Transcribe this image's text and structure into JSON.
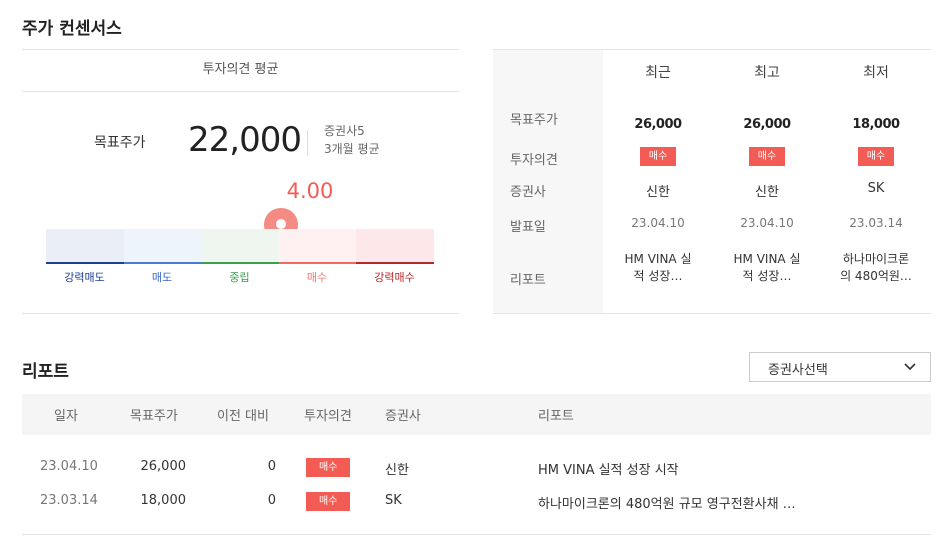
{
  "page": {
    "title": "주가 컨센서스"
  },
  "average": {
    "header": "투자의견 평균",
    "target_label": "목표주가",
    "target_value": "22,000",
    "brokers": "증권사5",
    "period": "3개월 평균",
    "score": "4.00",
    "score_value": 4.0,
    "scale": [
      {
        "label": "강력매도",
        "text_color": "#1f3f8f",
        "bg": "#e9eef7",
        "line": "#1f3f8f"
      },
      {
        "label": "매도",
        "text_color": "#3a6ac4",
        "bg": "#eef4fc",
        "line": "#4a7bd1"
      },
      {
        "label": "중립",
        "text_color": "#3b9b4c",
        "bg": "#eef6ef",
        "line": "#3e9d4f"
      },
      {
        "label": "매수",
        "text_color": "#f07a72",
        "bg": "#fff1f1",
        "line": "#f06a62"
      },
      {
        "label": "강력매수",
        "text_color": "#b3292b",
        "bg": "#fde7e8",
        "line": "#b3292b"
      }
    ],
    "accent": "#f25c54"
  },
  "compare": {
    "columns": [
      "최근",
      "최고",
      "최저"
    ],
    "row_labels": [
      "목표주가",
      "투자의견",
      "증권사",
      "발표일",
      "리포트"
    ],
    "cells": [
      {
        "target": "26,000",
        "opinion": "매수",
        "broker": "신한",
        "date": "23.04.10",
        "report": [
          "HM VINA 실",
          "적 성장…"
        ]
      },
      {
        "target": "26,000",
        "opinion": "매수",
        "broker": "신한",
        "date": "23.04.10",
        "report": [
          "HM VINA 실",
          "적 성장…"
        ]
      },
      {
        "target": "18,000",
        "opinion": "매수",
        "broker": "SK",
        "date": "23.03.14",
        "report": [
          "하나마이크론",
          "의 480억원…"
        ]
      }
    ]
  },
  "reports": {
    "title": "리포트",
    "select_label": "증권사선택",
    "headers": [
      "일자",
      "목표주가",
      "이전 대비",
      "투자의견",
      "증권사",
      "리포트"
    ],
    "rows": [
      {
        "date": "23.04.10",
        "target": "26,000",
        "change": "0",
        "opinion": "매수",
        "broker": "신한",
        "title": "HM VINA 실적 성장 시작"
      },
      {
        "date": "23.03.14",
        "target": "18,000",
        "change": "0",
        "opinion": "매수",
        "broker": "SK",
        "title": "하나마이크론의 480억원 규모 영구전환사채 …"
      }
    ]
  }
}
